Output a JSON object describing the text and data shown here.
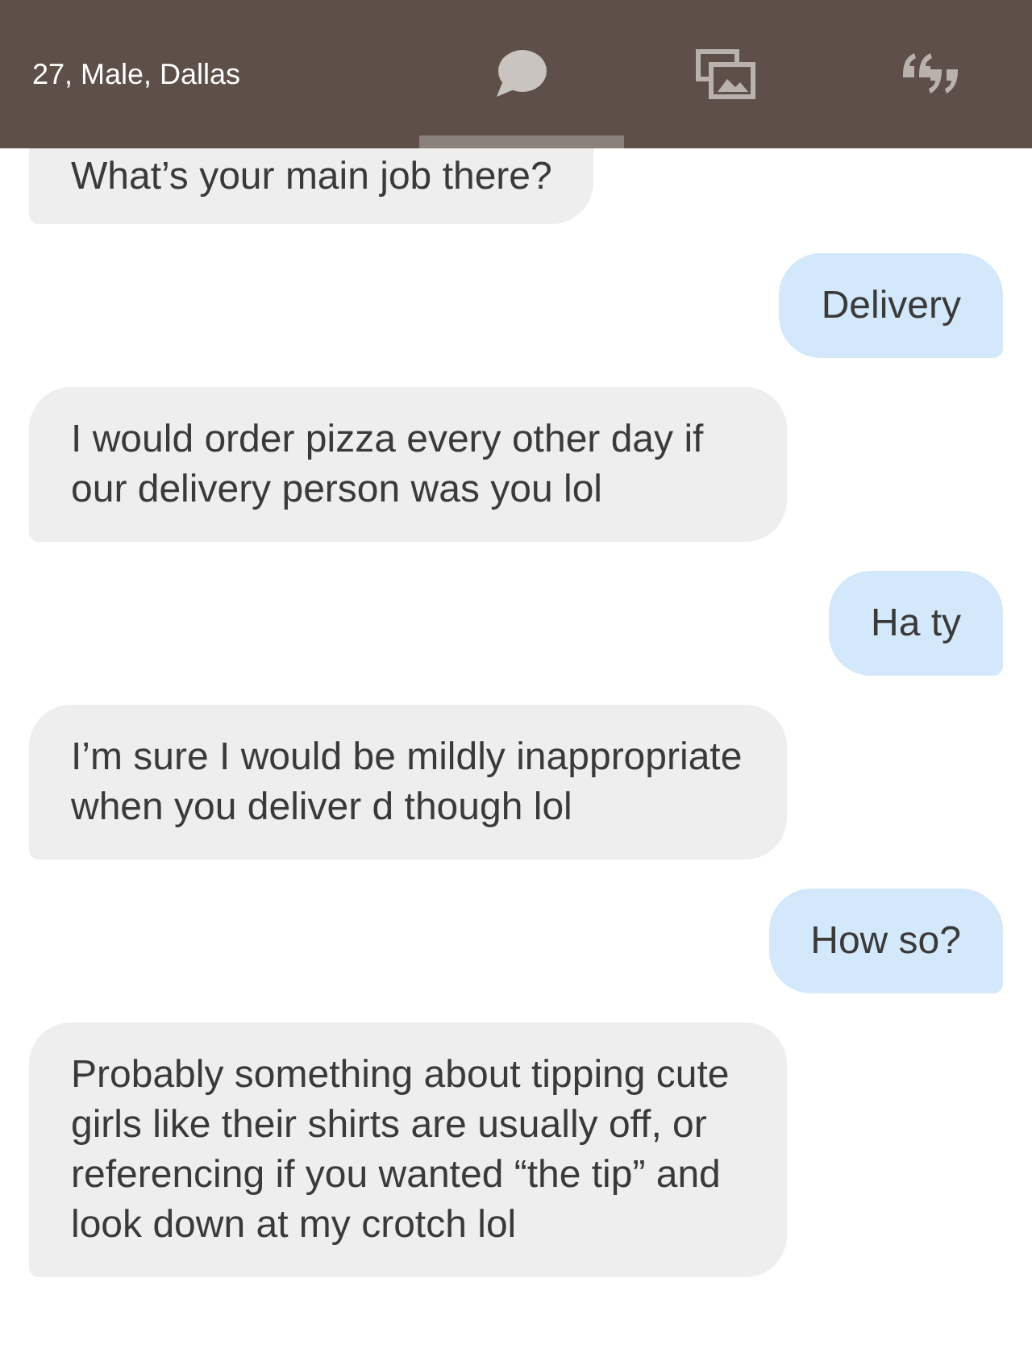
{
  "header": {
    "title": "27, Male, Dallas",
    "tabs": [
      {
        "kind": "chat",
        "selected": true
      },
      {
        "kind": "gallery",
        "selected": false
      },
      {
        "kind": "quotes",
        "selected": false
      }
    ]
  },
  "messages": [
    {
      "kind": "incoming",
      "text": "What’s your main job there?"
    },
    {
      "kind": "outgoing",
      "text": "Delivery"
    },
    {
      "kind": "incoming",
      "text": "I would order pizza every other day if our delivery person was you lol"
    },
    {
      "kind": "outgoing",
      "text": "Ha ty"
    },
    {
      "kind": "incoming",
      "text": "I’m sure I would be mildly inappropriate when you deliver d though lol"
    },
    {
      "kind": "outgoing",
      "text": "How so?"
    },
    {
      "kind": "incoming",
      "text": "Probably something about tipping cute girls like their shirts are usually off, or referencing if you wanted “the tip” and look down at my crotch lol"
    }
  ]
}
